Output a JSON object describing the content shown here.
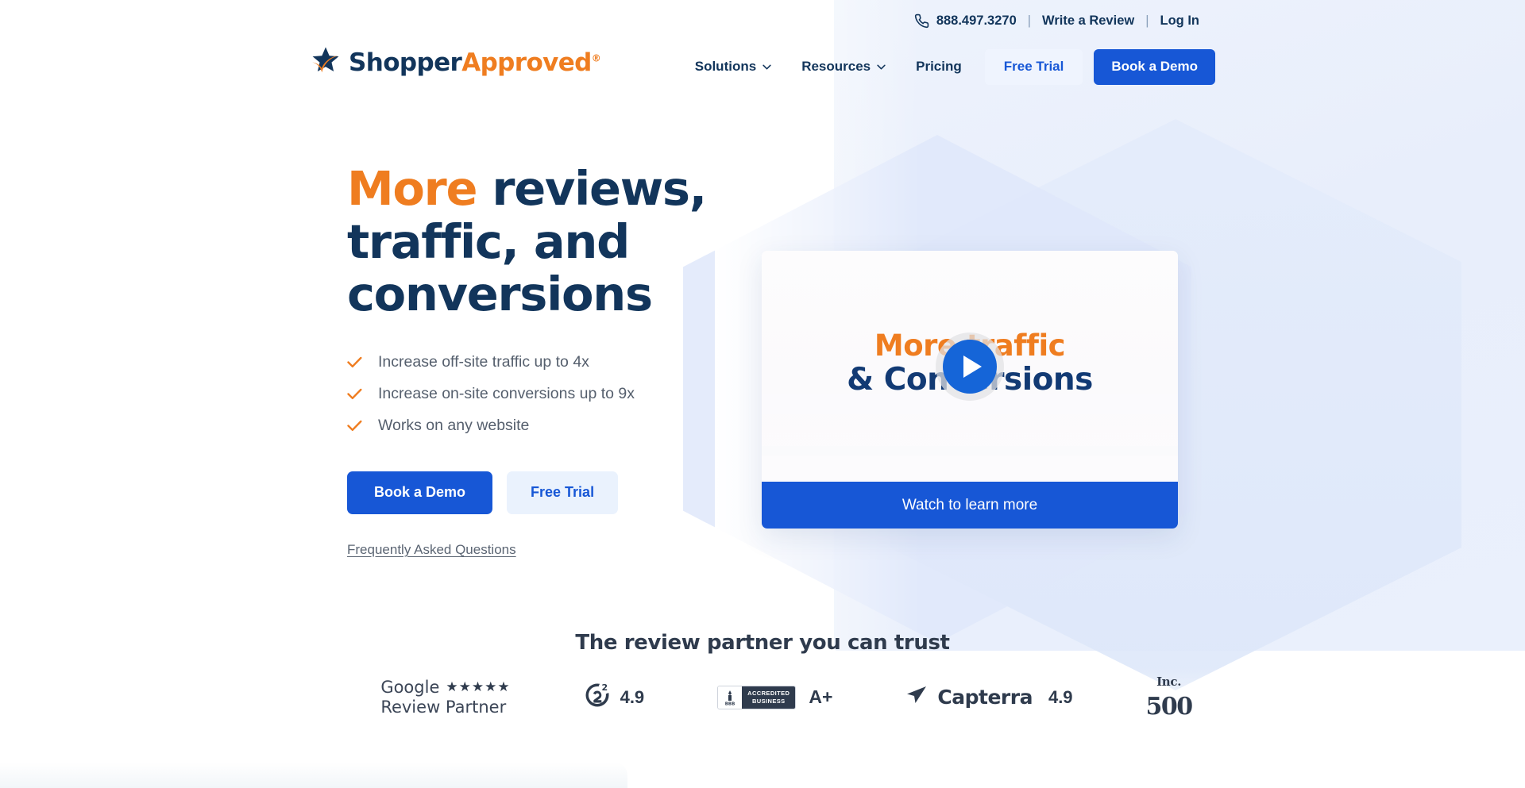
{
  "topbar": {
    "phone_icon": "phone-icon",
    "phone": "888.497.3270",
    "divider": "|",
    "write_review": "Write a Review",
    "login": "Log In"
  },
  "logo": {
    "icon": "star-swoosh-icon",
    "word1": "Shopper",
    "word2": "Approved",
    "registered": "®"
  },
  "nav": {
    "items": [
      {
        "label": "Solutions",
        "icon": "chevron-down-icon"
      },
      {
        "label": "Resources",
        "icon": "chevron-down-icon"
      },
      {
        "label": "Pricing",
        "icon": ""
      }
    ],
    "free_trial": "Free Trial",
    "book_demo": "Book a Demo"
  },
  "hero": {
    "title_accent": "More",
    "title_rest": " reviews, traffic, and conversions",
    "bullets": [
      {
        "icon": "check-icon",
        "text": "Increase off-site traffic up to 4x"
      },
      {
        "icon": "check-icon",
        "text": "Increase on-site conversions up to 9x"
      },
      {
        "icon": "check-icon",
        "text": "Works on any website"
      }
    ],
    "cta_primary": "Book a Demo",
    "cta_secondary": "Free Trial",
    "faq_link": "Frequently Asked Questions"
  },
  "video": {
    "thumb_line1": "More traffic",
    "thumb_line2": "& Conversions",
    "play_icon": "play-icon",
    "watch_label": "Watch to learn more"
  },
  "trust": {
    "title": "The review partner you can trust",
    "badges": [
      {
        "name": "google-review-partner",
        "word": "Google",
        "stars": "★★★★★",
        "sub": "Review Partner"
      },
      {
        "name": "g2",
        "icon": "g2-icon",
        "score": "4.9"
      },
      {
        "name": "bbb-accredited",
        "icon": "bbb-icon",
        "line1": "ACCREDITED",
        "line2": "BUSINESS",
        "mark": "BBB",
        "grade": "A+"
      },
      {
        "name": "capterra",
        "icon": "capterra-icon",
        "word": "Capterra",
        "score": "4.9"
      },
      {
        "name": "inc-500",
        "top": "Inc.",
        "bottom": "500"
      }
    ]
  },
  "colors": {
    "navy": "#12355b",
    "orange": "#ef7d20",
    "blue": "#1757d6",
    "pale_blue": "#eaf2fd",
    "slate": "#2f3b4d"
  }
}
